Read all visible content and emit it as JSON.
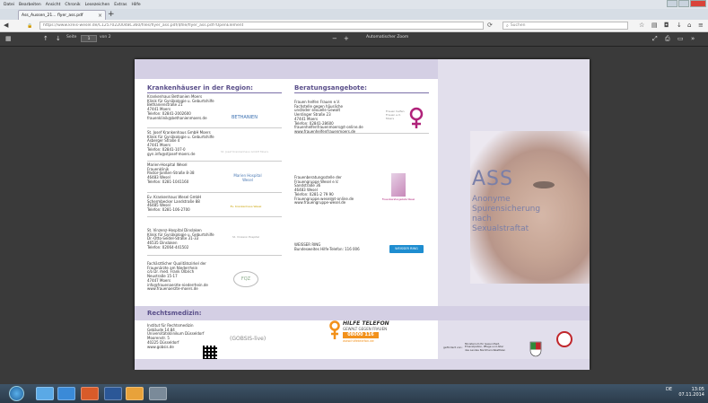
{
  "menubar": [
    "Datei",
    "Bearbeiten",
    "Ansicht",
    "Chronik",
    "Lesezeichen",
    "Extras",
    "Hilfe"
  ],
  "tab": {
    "label": "Ass_Aussen_21... flyer_ass.pdf",
    "close": "×"
  },
  "url": "https://www.kreis-wesel.de/C12570220048C360/files/flyer_ass.pdf/$file/flyer_ass.pdf?OpenElement",
  "search_placeholder": "Suchen",
  "pdf": {
    "page_label": "Seite",
    "page_value": "1",
    "page_of": "von 2",
    "zoom_label": "Automatischer Zoom"
  },
  "page": {
    "sec1_title": "Krankenhäuser in der Region:",
    "sec2_title": "Beratungsangebote:",
    "sec3_title": "Rechtsmedizin:",
    "hospitals": [
      {
        "text": "Krankenhaus Bethanien Moers\nKlinik für Gynäkologie u. Geburtshilfe\nBethanienstraße 21\n47441 Moers\nTelefon: 02841-2002600\nfrauenklinik@bethanienmoers.de",
        "logo": "BETHANIEN"
      },
      {
        "text": "St. Josef Krankenhaus GmbH Moers\nKlinik für Gynäkologie u. Geburtshilfe\nAsberger Straße 4\n47441 Moers\nTelefon: 02841-107-0\ngyn.info@stjosef-moers.de",
        "logo": "St. Josef Krankenhaus GmbH Moers"
      },
      {
        "text": "Marien-Hospital Wesel\nFrauenklinik\nPastor-Janßen-Straße 8-38\n46483 Wesel\nTelefon: 0281-1041160",
        "logo": "Marien Hospital Wesel"
      },
      {
        "text": "Ev. Krankenhaus Wesel GmbH\nSchermbecker Landstraße 88\n46485 Wesel\nTelefon: 0281-106-2700",
        "logo": "Ev. Krankenhaus Wesel"
      },
      {
        "text": "St. Vinzenz-Hospital Dinslaken\nKlinik für Gynäkologie u. Geburtshilfe\nDr.-Otto-Seidel-Straße 31-33\n46535 Dinslaken\nTelefon: 02064-441502",
        "logo": "St. Vinzenz-Hospital"
      },
      {
        "text": "Fachärztlicher Qualitätszirkel der\nFrauenärzte am Niederrhein\nc/o Dr. med. Frank Olbrich\nNeustraße 15-17\n47447 Moers\ninfo@frauenaerzte-niederrhein.de\nwww.frauenaerzte-moers.de",
        "logo": "FQZ"
      }
    ],
    "beratung": [
      {
        "text": "Frauen helfen Frauen e.V.\nFachstelle gegen häusliche\nund/oder sexuelle Gewalt\nUerdinger Straße 23\n47441 Moers\nTelefon: 02841-28600\nfrauenhelfenfrauenmoers@t-online.de\nwww.frauenhelfenfrauenmoers.de",
        "logo": "Frauen helfen Frauen e.V. Moers"
      },
      {
        "text": "Frauenberatungsstelle der\nFrauengruppe Wesel e.V.\nSandstraße 36\n46483 Wesel\nTelefon: 0281-2 79 90\nFrauengruppe.wesel@t-online.de\nwww.frauengruppe-wesel.de",
        "logo": "Frauenberatungsstelle Wesel"
      },
      {
        "text": "WEISSER RING\nBundesweites Hilfe-Telefon: 116 006",
        "logo": "WEISSER RING"
      }
    ],
    "rechtsmedizin": {
      "text": "Institut für Rechtsmedizin\nGebäude 14.84\nUniversitätsklinikum Düsseldorf\nMoorenstr. 5\n40225 Düsseldorf\nwww.gobsis.de",
      "logo": "(GOBSIS-live)"
    },
    "hilfe": {
      "title": "HILFE TELEFON",
      "subtitle": "GEWALT GEGEN FRAUEN",
      "number": "08000 116 016",
      "url": "www.hilfetelefon.de"
    },
    "gefoerdert": "gefördert von:",
    "ministerium": "Ministerium für Gesundheit,\nEmanzipation, Pflege und Alter\ndes Landes Nordrhein-Westfalen",
    "ass_title": "ASS",
    "ass_sub1": "Anonyme",
    "ass_sub2": "Spurensicherung",
    "ass_sub3": "nach",
    "ass_sub4": "Sexualstraftat"
  },
  "tray": {
    "lang": "DE",
    "time": "13:05",
    "date": "07.11.2014"
  },
  "colors": {
    "accent": "#5a4f8a",
    "stripe": "#d4cfe4",
    "orange": "#f2911b"
  }
}
